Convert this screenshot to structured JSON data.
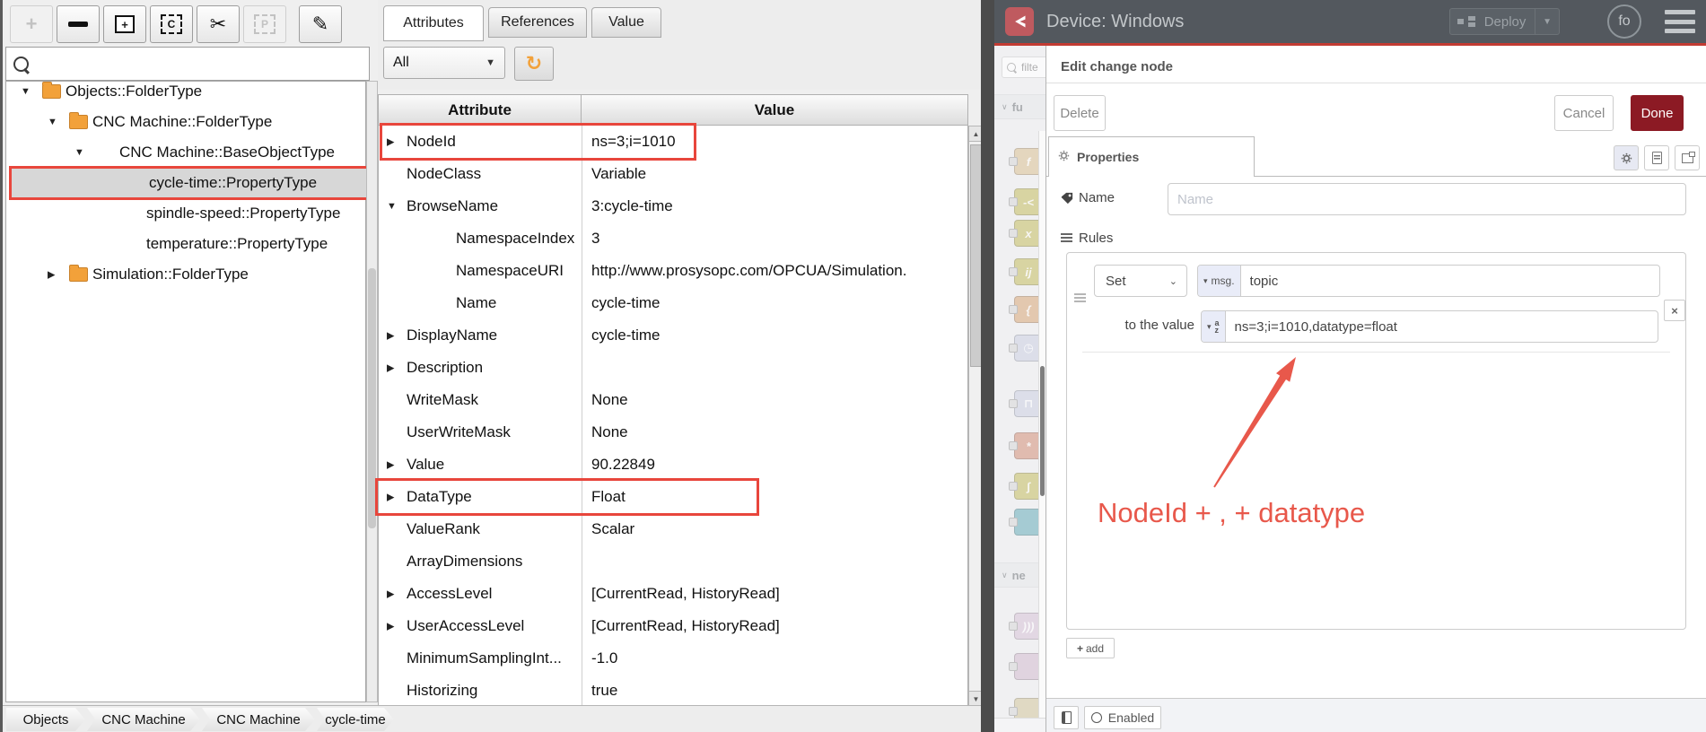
{
  "opcua": {
    "toolbar": [
      {
        "name": "add",
        "icon": "plus-icon",
        "disabled": true
      },
      {
        "name": "remove",
        "icon": "minus-icon",
        "disabled": false
      },
      {
        "name": "new-window",
        "icon": "window-plus-icon",
        "disabled": false
      },
      {
        "name": "copy",
        "icon": "copy-icon",
        "disabled": false
      },
      {
        "name": "cut",
        "icon": "scissors-icon",
        "disabled": false
      },
      {
        "name": "paste",
        "icon": "paste-icon",
        "disabled": true
      },
      {
        "name": "edit",
        "icon": "pencil-icon",
        "disabled": false
      }
    ],
    "tree": [
      {
        "label": "Objects::FolderType",
        "level": 0,
        "icon": "folder",
        "expander": "expanded",
        "selected": false
      },
      {
        "label": "CNC Machine::FolderType",
        "level": 1,
        "icon": "folder",
        "expander": "expanded",
        "selected": false
      },
      {
        "label": "CNC Machine::BaseObjectType",
        "level": 2,
        "icon": "object",
        "expander": "expanded",
        "selected": false
      },
      {
        "label": "cycle-time::PropertyType",
        "level": 3,
        "icon": "property",
        "expander": "none",
        "selected": true
      },
      {
        "label": "spindle-speed::PropertyType",
        "level": 3,
        "icon": "property",
        "expander": "none",
        "selected": false
      },
      {
        "label": "temperature::PropertyType",
        "level": 3,
        "icon": "property",
        "expander": "none",
        "selected": false
      },
      {
        "label": "Simulation::FolderType",
        "level": 1,
        "icon": "folder",
        "expander": "collapsed",
        "selected": false
      }
    ],
    "tabs": [
      {
        "label": "Attributes",
        "active": true
      },
      {
        "label": "References",
        "active": false
      },
      {
        "label": "Value",
        "active": false
      }
    ],
    "filter": {
      "value": "All"
    },
    "table": {
      "headers": [
        "Attribute",
        "Value"
      ],
      "rows": [
        {
          "arrow": "right",
          "indent": 0,
          "name": "NodeId",
          "value": "ns=3;i=1010",
          "boxed": true
        },
        {
          "arrow": "",
          "indent": 0,
          "name": "NodeClass",
          "value": "Variable",
          "boxed": false
        },
        {
          "arrow": "down",
          "indent": 0,
          "name": "BrowseName",
          "value": "3:cycle-time",
          "boxed": false
        },
        {
          "arrow": "",
          "indent": 1,
          "name": "NamespaceIndex",
          "value": "3",
          "boxed": false
        },
        {
          "arrow": "",
          "indent": 1,
          "name": "NamespaceURI",
          "value": "http://www.prosysopc.com/OPCUA/Simulation.",
          "boxed": false
        },
        {
          "arrow": "",
          "indent": 1,
          "name": "Name",
          "value": "cycle-time",
          "boxed": false
        },
        {
          "arrow": "right",
          "indent": 0,
          "name": "DisplayName",
          "value": "cycle-time",
          "boxed": false
        },
        {
          "arrow": "right",
          "indent": 0,
          "name": "Description",
          "value": "",
          "boxed": false
        },
        {
          "arrow": "",
          "indent": 0,
          "name": "WriteMask",
          "value": "None",
          "boxed": false
        },
        {
          "arrow": "",
          "indent": 0,
          "name": "UserWriteMask",
          "value": "None",
          "boxed": false
        },
        {
          "arrow": "right",
          "indent": 0,
          "name": "Value",
          "value": "90.22849",
          "boxed": false
        },
        {
          "arrow": "right",
          "indent": 0,
          "name": "DataType",
          "value": "Float",
          "boxed": true
        },
        {
          "arrow": "",
          "indent": 0,
          "name": "ValueRank",
          "value": "Scalar",
          "boxed": false
        },
        {
          "arrow": "",
          "indent": 0,
          "name": "ArrayDimensions",
          "value": "",
          "boxed": false
        },
        {
          "arrow": "right",
          "indent": 0,
          "name": "AccessLevel",
          "value": "[CurrentRead, HistoryRead]",
          "boxed": false
        },
        {
          "arrow": "right",
          "indent": 0,
          "name": "UserAccessLevel",
          "value": "[CurrentRead, HistoryRead]",
          "boxed": false
        },
        {
          "arrow": "",
          "indent": 0,
          "name": "MinimumSamplingInt...",
          "value": "-1.0",
          "boxed": false
        },
        {
          "arrow": "",
          "indent": 0,
          "name": "Historizing",
          "value": "true",
          "boxed": false
        }
      ]
    },
    "breadcrumbs": [
      "Objects",
      "CNC Machine",
      "CNC Machine",
      "cycle-time"
    ]
  },
  "nodered": {
    "header": {
      "title": "Device: Windows",
      "deploy_label": "Deploy",
      "user_initials": "fo"
    },
    "palette": {
      "search_placeholder": "filte",
      "sections": [
        {
          "label": "fu"
        },
        {
          "label": "ne"
        }
      ],
      "nodes": [
        {
          "name": "function",
          "glyph": "f",
          "color": "#d8bd90"
        },
        {
          "name": "switch",
          "glyph": "-<",
          "color": "#c2ba5e"
        },
        {
          "name": "change",
          "glyph": "x",
          "color": "#c2ba5e"
        },
        {
          "name": "range",
          "glyph": "ij",
          "color": "#c2ba5e"
        },
        {
          "name": "template",
          "glyph": "{",
          "color": "#d5a576"
        },
        {
          "name": "delay",
          "glyph": "◷",
          "color": "#c8cddf"
        },
        {
          "name": "trigger",
          "glyph": "⊓",
          "color": "#c8cddf"
        },
        {
          "name": "exec",
          "glyph": "*",
          "color": "#d08d76"
        },
        {
          "name": "filter",
          "glyph": "∫",
          "color": "#c2ba5e"
        },
        {
          "name": "teal-node",
          "glyph": "",
          "color": "#64aab6"
        },
        {
          "name": "mqtt-in",
          "glyph": ")))",
          "color": "#d3c0d3"
        },
        {
          "name": "mqtt-out",
          "glyph": "",
          "color": "#cfb9cc"
        },
        {
          "name": "http-request",
          "glyph": "",
          "color": "#cfc49a"
        }
      ]
    },
    "editor": {
      "title": "Edit change node",
      "delete_label": "Delete",
      "cancel_label": "Cancel",
      "done_label": "Done",
      "tab_label": "Properties",
      "name_label": "Name",
      "name_placeholder": "Name",
      "rules_label": "Rules",
      "rule": {
        "action": "Set",
        "property_prefix": "msg.",
        "property": "topic",
        "to_label": "to the value",
        "value": "ns=3;i=1010,datatype=float"
      },
      "add_label": "add",
      "enabled_label": "Enabled"
    },
    "annotation": {
      "text": "NodeId + , + datatype",
      "color": "#e8584b"
    }
  }
}
